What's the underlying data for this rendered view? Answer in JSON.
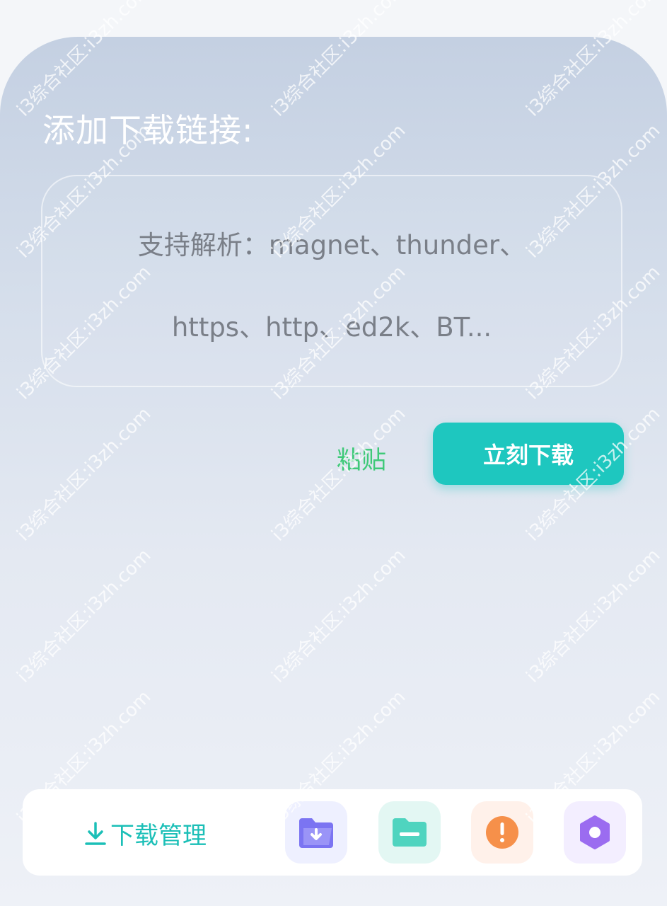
{
  "header": {
    "title": "添加下载链接:"
  },
  "link_input": {
    "placeholder_line1": "支持解析：magnet、thunder、",
    "placeholder_line2": "https、http、ed2k、BT..."
  },
  "actions": {
    "paste_label": "粘贴",
    "download_label": "立刻下载"
  },
  "bottom_bar": {
    "manage_label": "下载管理",
    "icons": [
      "folder-download-icon",
      "folder-icon",
      "alert-icon",
      "settings-icon"
    ]
  },
  "watermark": {
    "text": "i3综合社区:i3zh.com"
  },
  "colors": {
    "accent": "#1ec7bf",
    "paste": "#3ec978",
    "purple": "#7b74f2",
    "teal": "#4fd4bf",
    "orange": "#f6904a",
    "violet": "#9b6cf0"
  }
}
